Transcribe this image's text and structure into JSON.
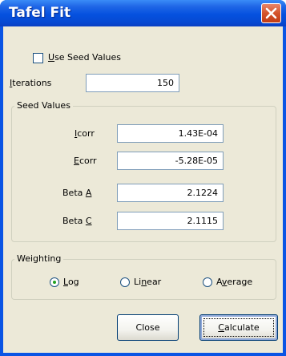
{
  "window": {
    "title": "Tafel Fit",
    "title_bar_color": "#0a54e4",
    "client_bg": "#ece9d8"
  },
  "options": {
    "use_seed_values": {
      "label_mnemonic": "U",
      "label_rest": "se Seed Values",
      "checked": false
    },
    "iterations": {
      "label_mnemonic": "I",
      "label_rest": "terations",
      "value": "150"
    }
  },
  "seed_values": {
    "caption": "Seed Values",
    "icorr": {
      "label_mnemonic": "I",
      "label_rest": "corr",
      "value": "1.43E-04"
    },
    "ecorr": {
      "label_mnemonic": "E",
      "label_rest": "corr",
      "value": "-5.28E-05"
    },
    "beta_a": {
      "label_prefix": "Beta ",
      "label_mnemonic": "A",
      "value": "2.1224"
    },
    "beta_c": {
      "label_prefix": "Beta ",
      "label_mnemonic": "C",
      "value": "2.1115"
    }
  },
  "weighting": {
    "caption": "Weighting",
    "selected": "Log",
    "options": [
      {
        "pre": "",
        "mnemonic": "L",
        "post": "og"
      },
      {
        "pre": "Li",
        "mnemonic": "n",
        "post": "ear"
      },
      {
        "pre": "A",
        "mnemonic": "v",
        "post": "erage"
      }
    ]
  },
  "buttons": {
    "close": {
      "label": "Close"
    },
    "calculate": {
      "mnemonic": "C",
      "rest": "alculate"
    }
  },
  "icons": {
    "close": "close-x-icon",
    "radio_selected_color": "#21a121"
  }
}
